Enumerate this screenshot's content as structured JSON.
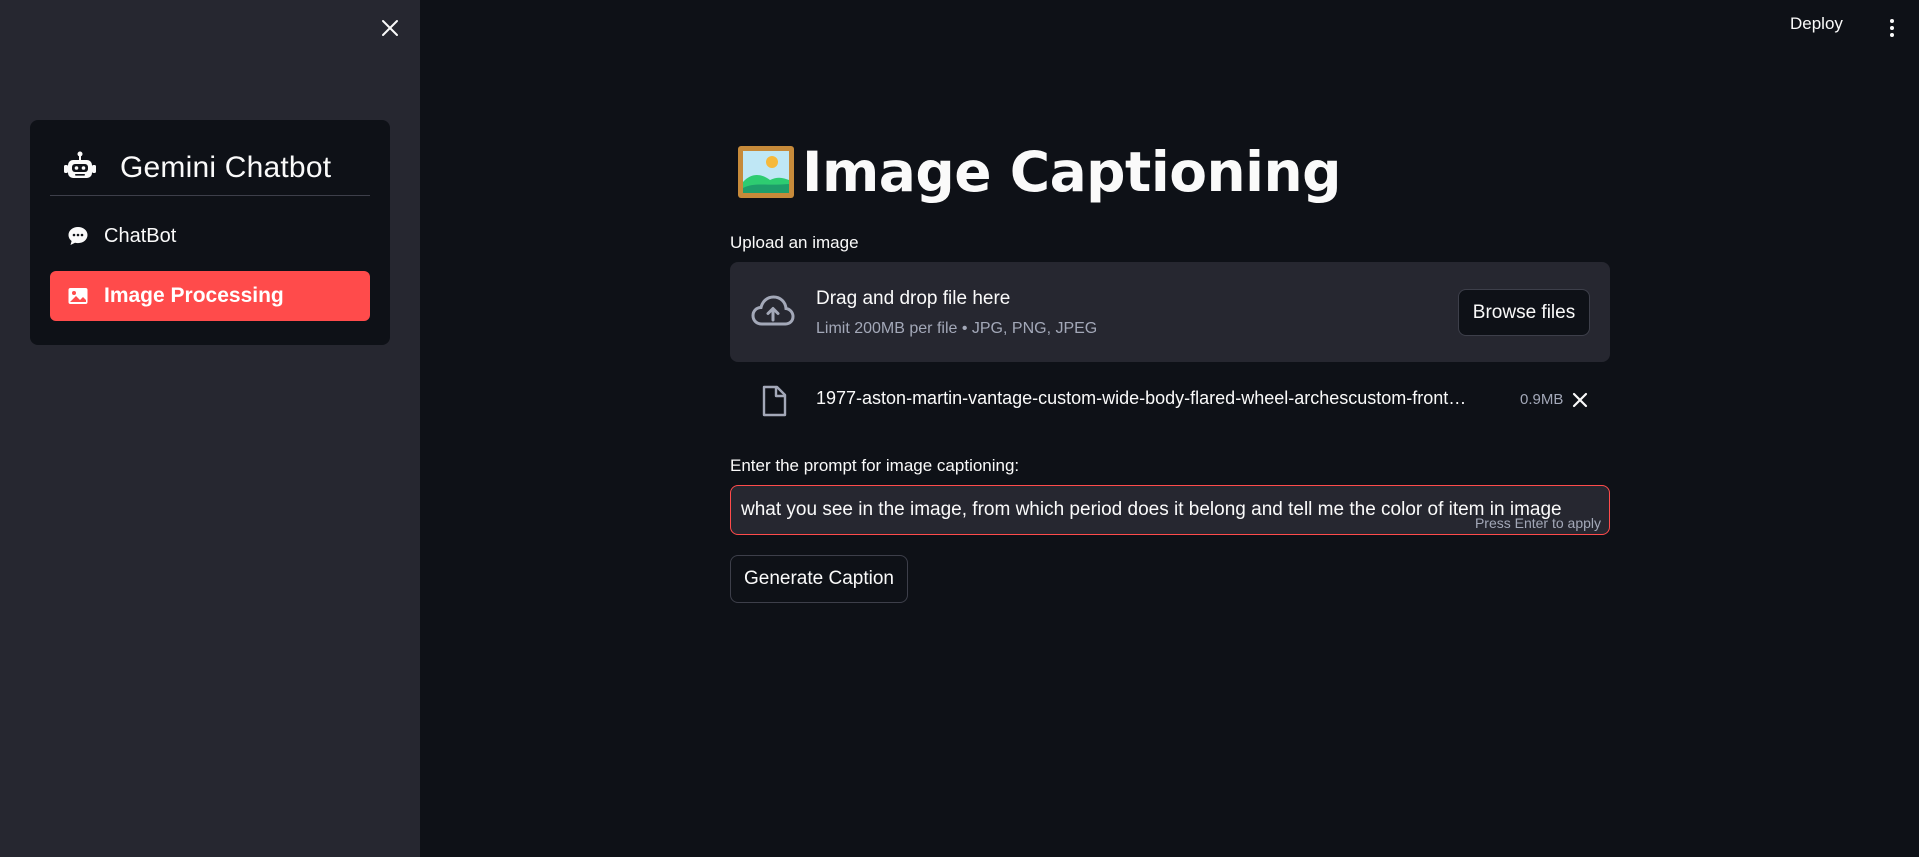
{
  "sidebar": {
    "title": "Gemini Chatbot",
    "items": [
      {
        "label": "ChatBot",
        "icon": "chat-bubble-icon",
        "active": false
      },
      {
        "label": "Image Processing",
        "icon": "image-icon",
        "active": true
      }
    ]
  },
  "header": {
    "deploy_label": "Deploy"
  },
  "main": {
    "title": "Image Captioning",
    "title_icon": "framed-picture-icon",
    "upload": {
      "label": "Upload an image",
      "drop_title": "Drag and drop file here",
      "drop_subtitle": "Limit 200MB per file • JPG, PNG, JPEG",
      "browse_label": "Browse files"
    },
    "file": {
      "name": "1977-aston-martin-vantage-custom-wide-body-flared-wheel-archescustom-front…",
      "size": "0.9MB"
    },
    "prompt": {
      "label": "Enter the prompt for image captioning:",
      "value": "what you see in the image, from which period does it belong and tell me the color of item in image",
      "hint": "Press Enter to apply"
    },
    "generate_label": "Generate Caption"
  },
  "colors": {
    "background": "#0e1117",
    "sidebar": "#262730",
    "accent": "#ff4b4b",
    "muted_text": "#a3a8b8"
  }
}
